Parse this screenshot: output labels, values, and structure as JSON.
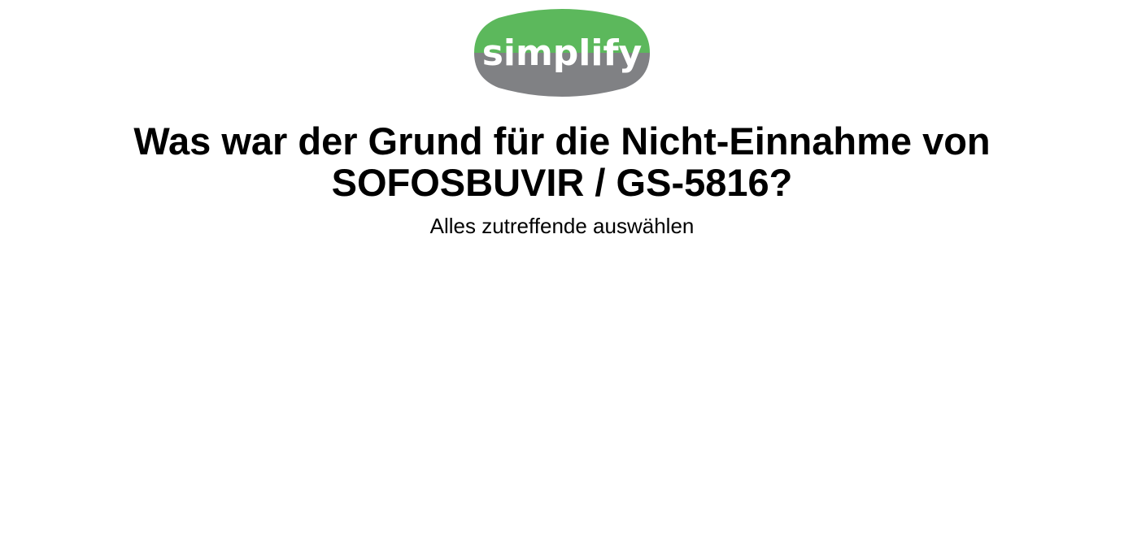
{
  "logo": {
    "text": "simplify",
    "colors": {
      "top": "#5cb85c",
      "bottom": "#808184",
      "text": "#ffffff"
    }
  },
  "question": {
    "line1": "Was war der Grund für die Nicht-Einnahme von",
    "line2": "SOFOSBUVIR / GS-5816?"
  },
  "instruction": "Alles zutreffende auswählen"
}
